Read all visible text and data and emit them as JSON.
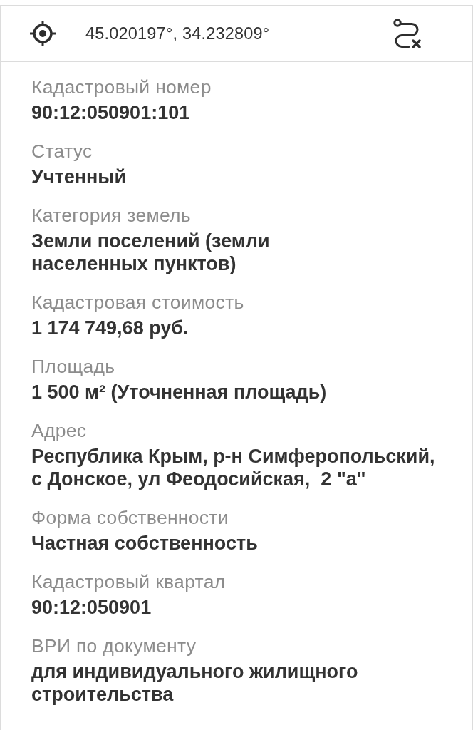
{
  "location_bar": {
    "coordinates": "45.020197°, 34.232809°"
  },
  "fields": [
    {
      "label": "Кадастровый номер",
      "value": "90:12:050901:101"
    },
    {
      "label": "Статус",
      "value": "Учтенный"
    },
    {
      "label": "Категория земель",
      "value": "Земли поселений (земли\nнаселенных пунктов)"
    },
    {
      "label": "Кадастровая стоимость",
      "value": "1 174 749,68 руб."
    },
    {
      "label": "Площадь",
      "value": "1 500 м² (Уточненная площадь)"
    },
    {
      "label": "Адрес",
      "value": "Республика Крым, р-н Симферопольский,\nс Донское, ул Феодосийская,  2 \"а\""
    },
    {
      "label": "Форма собственности",
      "value": "Частная собственность"
    },
    {
      "label": "Кадастровый квартал",
      "value": "90:12:050901"
    },
    {
      "label": "ВРИ по документу",
      "value": "для индивидуального жилищного\nстроительства"
    }
  ]
}
